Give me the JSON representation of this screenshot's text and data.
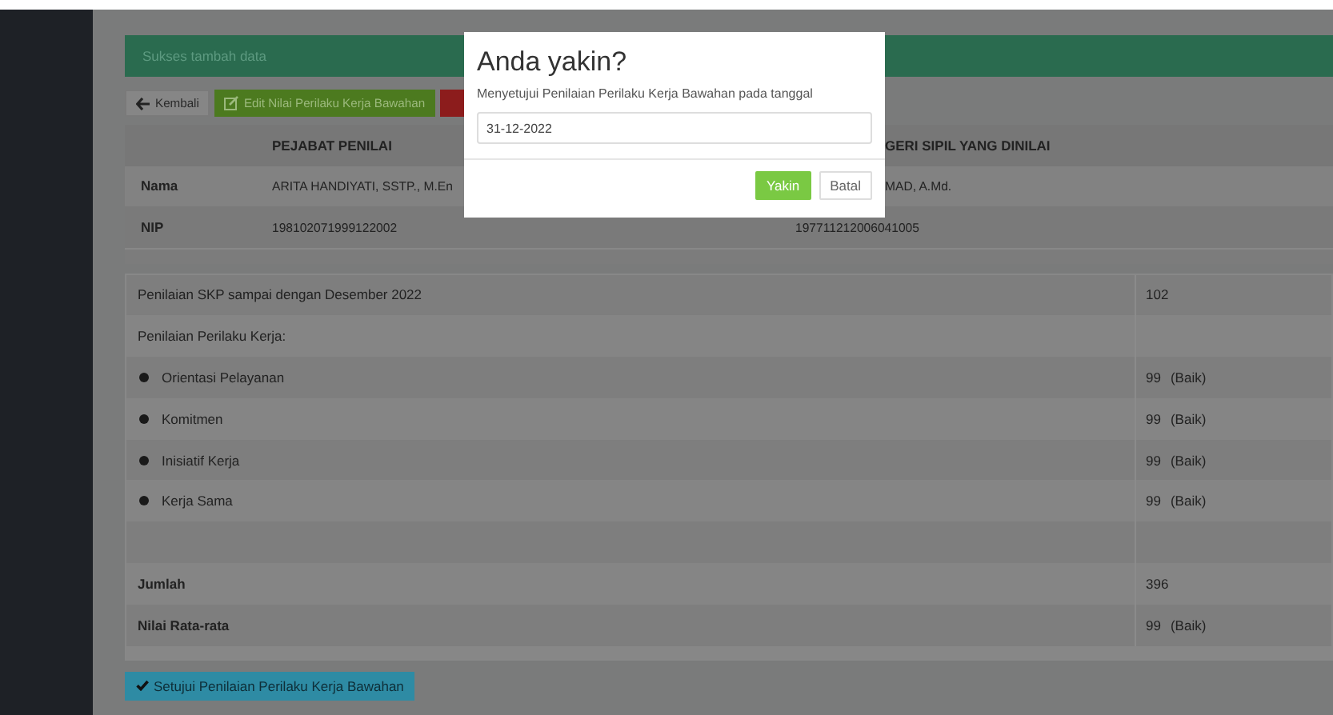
{
  "alert": "Sukses tambah data",
  "toolbar": [
    {
      "kind": "back",
      "label": "Kembali"
    },
    {
      "kind": "edit",
      "label": "Edit Nilai Perilaku Kerja Bawahan"
    },
    {
      "kind": "danger"
    }
  ],
  "identity": {
    "columns": [
      "PEJABAT PENILAI",
      "GERI SIPIL YANG DINILAI"
    ],
    "rows": [
      {
        "label": "Nama",
        "values": [
          "ARITA HANDIYATI, SSTP., M.En",
          "MAD, A.Md."
        ]
      },
      {
        "label": "NIP",
        "values": [
          "198102071999122002",
          "197711212006041005"
        ]
      }
    ]
  },
  "scores": [
    {
      "kind": "text",
      "label": "Penilaian SKP sampai dengan Desember 2022",
      "value": "102"
    },
    {
      "kind": "text",
      "label": "Penilaian Perilaku Kerja:"
    },
    {
      "kind": "bullet",
      "label": "Orientasi Pelayanan",
      "value": "99",
      "grade": "(Baik)"
    },
    {
      "kind": "bullet",
      "label": "Komitmen",
      "value": "99",
      "grade": "(Baik)"
    },
    {
      "kind": "bullet",
      "label": "Inisiatif Kerja",
      "value": "99",
      "grade": "(Baik)"
    },
    {
      "kind": "bullet",
      "label": "Kerja Sama",
      "value": "99",
      "grade": "(Baik)"
    },
    {
      "kind": "blank"
    },
    {
      "kind": "total",
      "label": "Jumlah",
      "value": "396"
    },
    {
      "kind": "total",
      "label": "Nilai Rata-rata",
      "value": "99",
      "grade": "(Baik)"
    }
  ],
  "submit_button": "Setujui Penilaian Perilaku Kerja Bawahan",
  "modal": {
    "title": "Anda yakin?",
    "message": "Menyetujui Penilaian Perilaku Kerja Bawahan pada tanggal",
    "date": "31-12-2022",
    "buttons": [
      {
        "kind": "primary",
        "label": "Yakin"
      },
      {
        "kind": "default",
        "label": "Batal"
      }
    ]
  }
}
